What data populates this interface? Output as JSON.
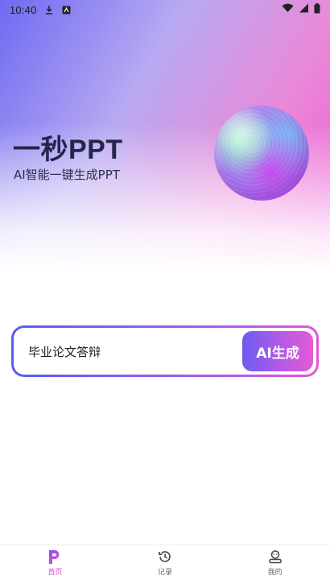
{
  "status_bar": {
    "time": "10:40",
    "icons": [
      "download-icon",
      "notification-app-icon",
      "wifi-icon",
      "signal-icon",
      "battery-icon"
    ]
  },
  "hero": {
    "title": "一秒PPT",
    "subtitle": "AI智能一键生成PPT"
  },
  "prompt": {
    "value": "毕业论文答辩",
    "button_label": "AI生成"
  },
  "bottom_nav": {
    "items": [
      {
        "label": "首页",
        "icon": "brand-p-icon",
        "active": true
      },
      {
        "label": "记录",
        "icon": "history-icon",
        "active": false
      },
      {
        "label": "我的",
        "icon": "profile-icon",
        "active": false
      }
    ]
  },
  "colors": {
    "accent_start": "#5b5cf0",
    "accent_end": "#e456d8",
    "title": "#23264a",
    "active_nav": "#e24bd6"
  }
}
